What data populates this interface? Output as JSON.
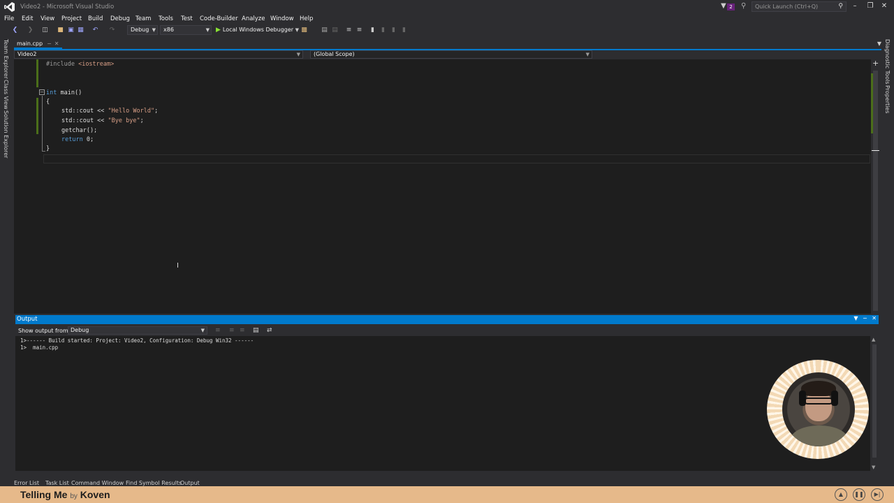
{
  "window": {
    "title": "Video2 - Microsoft Visual Studio",
    "notifications_count": "2",
    "quick_launch_placeholder": "Quick Launch (Ctrl+Q)"
  },
  "menu": {
    "items": [
      "File",
      "Edit",
      "View",
      "Project",
      "Build",
      "Debug",
      "Team",
      "Tools",
      "Test",
      "Code-Builder",
      "Analyze",
      "Window",
      "Help"
    ]
  },
  "toolbar": {
    "configuration": "Debug",
    "platform": "x86",
    "run_label": "Local Windows Debugger"
  },
  "side_tabs_left": [
    "Team Explorer",
    "Class View",
    "Solution Explorer"
  ],
  "side_tabs_right": [
    "Diagnostic Tools",
    "Properties"
  ],
  "document_tab": {
    "label": "main.cpp"
  },
  "navbar": {
    "project": "Video2",
    "scope": "(Global Scope)"
  },
  "code": {
    "line1_directive": "#include",
    "line1_header": "<iostream>",
    "line4_kw": "int",
    "line4_rest": " main()",
    "line5": "{",
    "line6_pre": "std::cout << ",
    "line6_str": "\"Hello World\"",
    "line6_post": ";",
    "line7_pre": "std::cout << ",
    "line7_str": "\"Bye bye\"",
    "line7_post": ";",
    "line8": "getchar();",
    "line9_kw": "return",
    "line9_rest": " 0;",
    "line10": "}"
  },
  "output": {
    "title": "Output",
    "show_from_label": "Show output from:",
    "show_from_value": "Debug",
    "lines": [
      "1>------ Build started: Project: Video2, Configuration: Debug Win32 ------",
      "1>  main.cpp"
    ]
  },
  "bottom_tabs": [
    "Error List",
    "Task List",
    "Command Window",
    "Find Symbol Results",
    "Output"
  ],
  "music": {
    "title": "Telling Me",
    "by": "by",
    "artist": "Koven"
  }
}
